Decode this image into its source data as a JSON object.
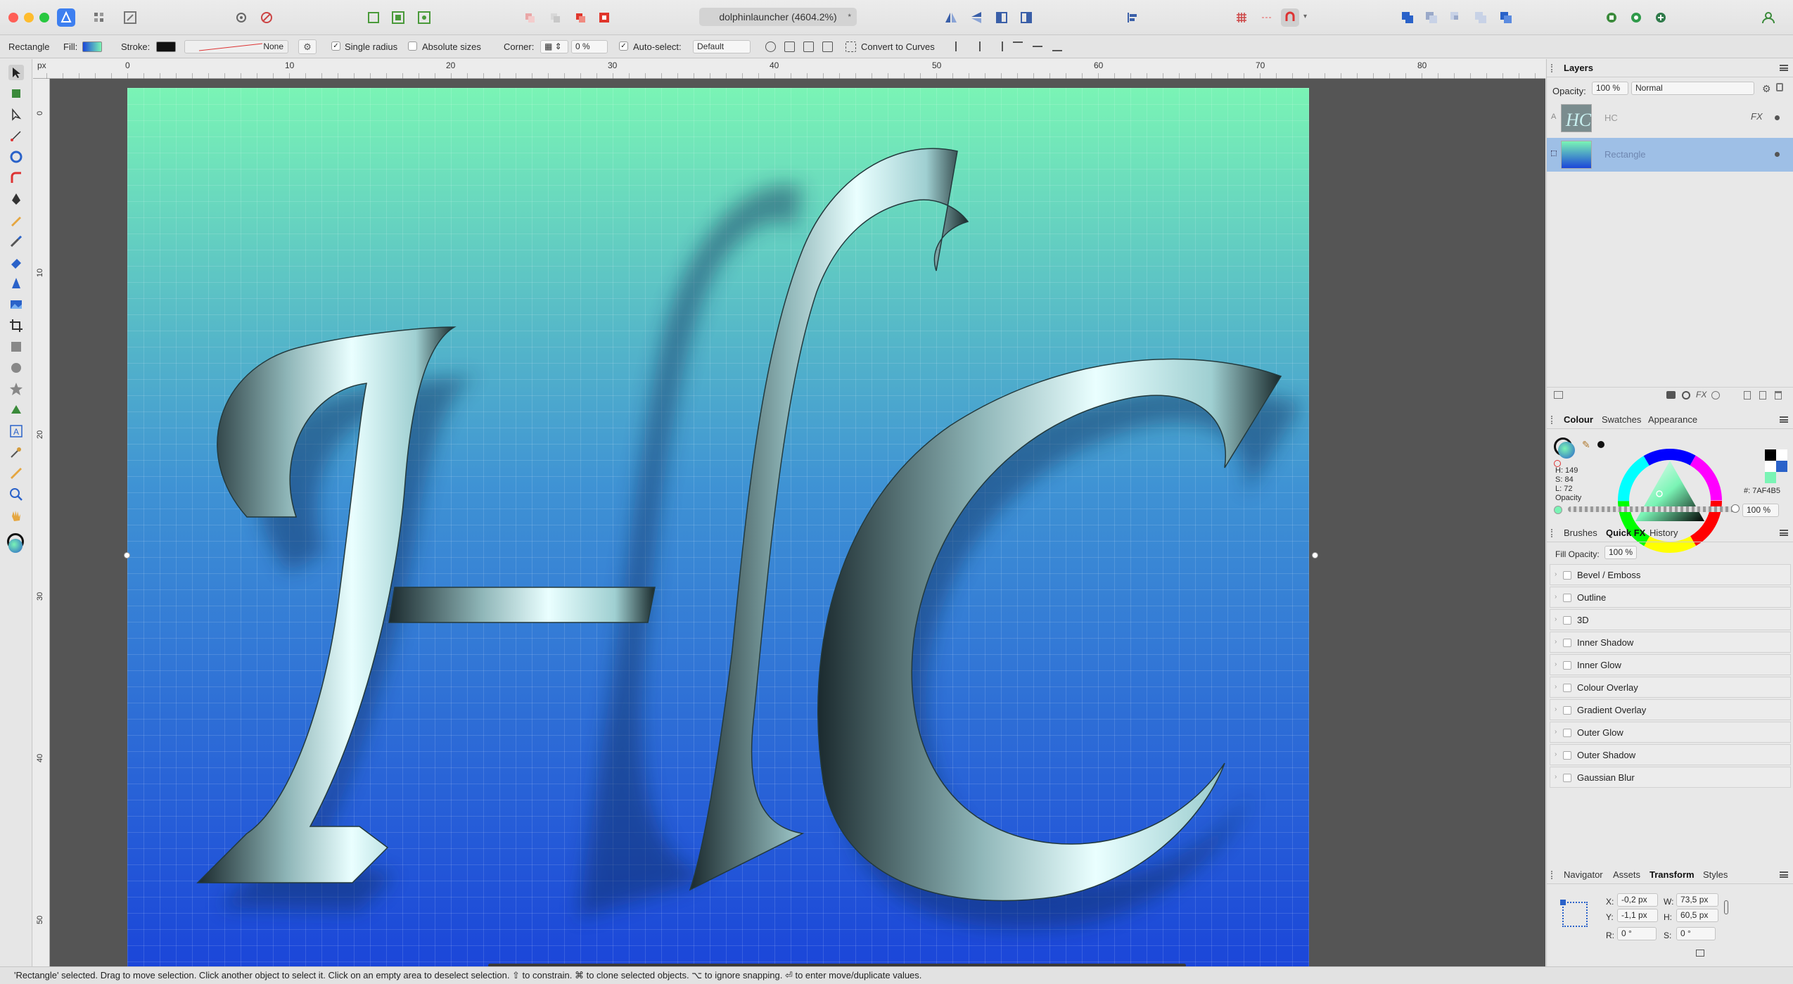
{
  "window": {
    "document_tab": "dolphinlauncher (4604.2%)",
    "modified_marker": "*"
  },
  "context_toolbar": {
    "object_type": "Rectangle",
    "fill_label": "Fill:",
    "stroke_label": "Stroke:",
    "stroke_none": "None",
    "single_radius": "Single radius",
    "absolute_sizes": "Absolute sizes",
    "corner_label": "Corner:",
    "corner_value": "0 %",
    "auto_select_label": "Auto-select:",
    "auto_select_value": "Default",
    "convert_to_curves": "Convert to Curves"
  },
  "ruler": {
    "unit": "px",
    "h_ticks": [
      "0",
      "10",
      "20",
      "30",
      "40",
      "50",
      "60",
      "70",
      "80"
    ],
    "v_ticks": [
      "0",
      "10",
      "20",
      "30",
      "40",
      "50"
    ]
  },
  "artwork": {
    "letters": "HC",
    "gradient_top": "#7AF4B5",
    "gradient_mid": "#3f93d4",
    "gradient_bottom": "#1b46d9"
  },
  "layers_panel": {
    "title": "Layers",
    "opacity_label": "Opacity:",
    "opacity_value": "100 %",
    "blend_mode": "Normal",
    "layers": [
      {
        "name": "HC",
        "type_marker": "A"
      },
      {
        "name": "Rectangle",
        "selected": true
      }
    ]
  },
  "colour_panel": {
    "tabs": [
      "Colour",
      "Swatches",
      "Appearance"
    ],
    "h": "H: 149",
    "s": "S: 84",
    "l": "L: 72",
    "hex": "#: 7AF4B5",
    "opacity_label": "Opacity",
    "opacity_value": "100 %",
    "current_colour": "#7AF4B5"
  },
  "fx_panel": {
    "tabs": [
      "Brushes",
      "Quick FX",
      "History"
    ],
    "fill_opacity_label": "Fill Opacity:",
    "fill_opacity_value": "100 %",
    "effects": [
      "Bevel / Emboss",
      "Outline",
      "3D",
      "Inner Shadow",
      "Inner Glow",
      "Colour Overlay",
      "Gradient Overlay",
      "Outer Glow",
      "Outer Shadow",
      "Gaussian Blur"
    ]
  },
  "transform_panel": {
    "tabs": [
      "Navigator",
      "Assets",
      "Transform",
      "Styles"
    ],
    "x_label": "X:",
    "x_value": "-0,2 px",
    "y_label": "Y:",
    "y_value": "-1,1 px",
    "w_label": "W:",
    "w_value": "73,5 px",
    "h_label": "H:",
    "h_value": "60,5 px",
    "r_label": "R:",
    "r_value": "0 °",
    "s_label": "S:",
    "s_value": "0 °"
  },
  "status_bar": {
    "text": "'Rectangle' selected. Drag to move selection. Click another object to select it. Click on an empty area to deselect selection. ⇧ to constrain. ⌘ to clone selected objects. ⌥ to ignore snapping. ⏎ to enter move/duplicate values."
  }
}
